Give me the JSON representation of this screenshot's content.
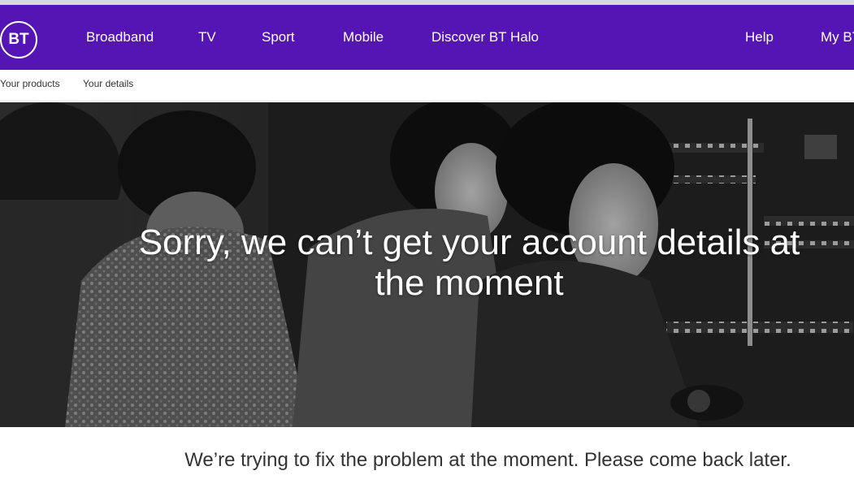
{
  "brand": {
    "logo_text": "BT",
    "nav_color": "#5514b4"
  },
  "nav": {
    "broadband": "Broadband",
    "tv": "TV",
    "sport": "Sport",
    "mobile": "Mobile",
    "halo": "Discover BT Halo",
    "help": "Help",
    "my_bt": "My BT"
  },
  "subnav": {
    "products": "Your products",
    "details": "Your details"
  },
  "hero": {
    "title": "Sorry, we can’t get your account details at the moment",
    "image": "black-and-white photo of switchboard operators"
  },
  "message": "We’re trying to fix the problem at the moment. Please come back later."
}
